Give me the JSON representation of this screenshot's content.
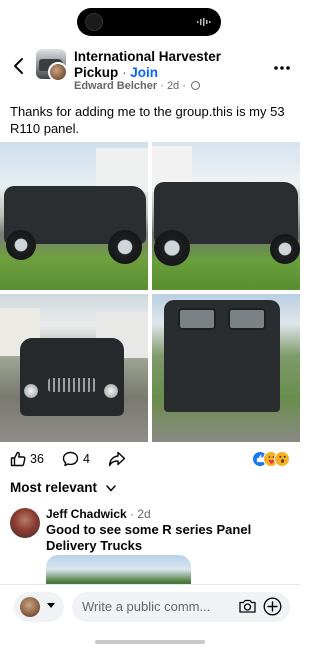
{
  "group": {
    "name": "International Harvester Pickup",
    "separator": "·",
    "join_label": "Join"
  },
  "post": {
    "author": "Edward Belcher",
    "separator": "·",
    "time": "2d",
    "text": "Thanks for adding me to the group.this is my 53 R110 panel.",
    "reactions_count": "36",
    "comments_count": "4"
  },
  "comments": {
    "sort_label": "Most relevant",
    "items": [
      {
        "author": "Jeff Chadwick",
        "time": "· 2d",
        "text": "Good to see some R series Panel Delivery Trucks"
      }
    ]
  },
  "composer": {
    "placeholder": "Write a public comm..."
  },
  "icons": {
    "back": "chevron-left-icon",
    "more": "more-horizontal-icon",
    "privacy": "globe-icon",
    "like": "thumbs-up-icon",
    "comment": "speech-bubble-icon",
    "share": "share-arrow-icon",
    "camera": "camera-icon",
    "add": "plus-circle-icon"
  },
  "colors": {
    "accent": "#0866ff",
    "secondary_text": "#65676b",
    "primary_text": "#050505",
    "pill_background": "#f0f2f5"
  }
}
